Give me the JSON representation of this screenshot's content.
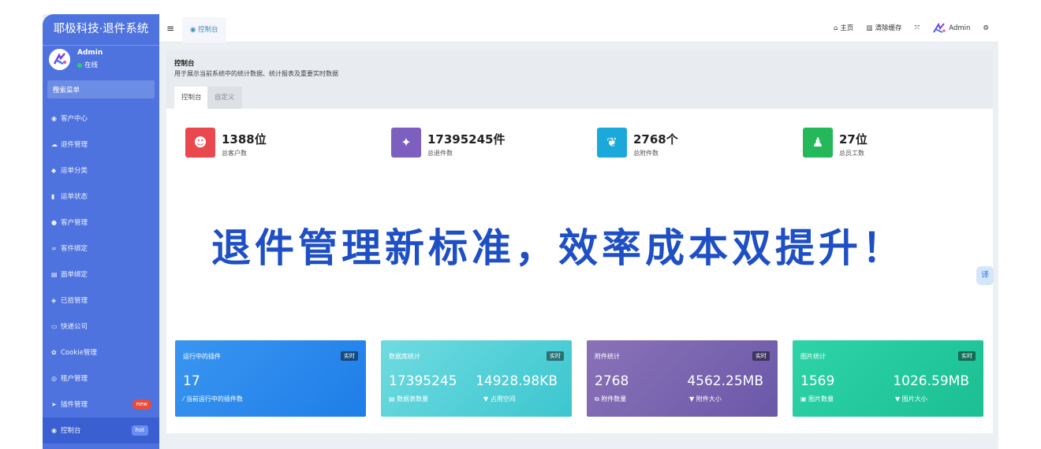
{
  "app": {
    "title": "耶极科技·退件系统"
  },
  "user": {
    "name": "Admin",
    "status": "在线"
  },
  "search": {
    "placeholder": "搜索菜单"
  },
  "menu": [
    {
      "label": "客户中心"
    },
    {
      "label": "退件管理"
    },
    {
      "label": "运单分类"
    },
    {
      "label": "运单状态"
    },
    {
      "label": "客户管理"
    },
    {
      "label": "客件绑定"
    },
    {
      "label": "面单绑定"
    },
    {
      "label": "已拾管理"
    },
    {
      "label": "快递公司"
    },
    {
      "label": "Cookie管理"
    },
    {
      "label": "租户管理"
    },
    {
      "label": "插件管理",
      "badge": "new"
    },
    {
      "label": "控制台",
      "badge": "hot"
    }
  ],
  "topbar": {
    "menu_glyph": "≡",
    "tab": "控制台",
    "home": "主页",
    "clear_cache": "清除缓存",
    "admin": "Admin"
  },
  "panel": {
    "title": "控制台",
    "description": "用于展示当前系统中的统计数据、统计报表及重要实时数据",
    "tabs": [
      "控制台",
      "自定义"
    ]
  },
  "stats": [
    {
      "value": "1388位",
      "label": "总客户数",
      "color": "#e9484f"
    },
    {
      "value": "17395245件",
      "label": "总退件数",
      "color": "#7c5fbf"
    },
    {
      "value": "2768个",
      "label": "总附件数",
      "color": "#1ba9db"
    },
    {
      "value": "27位",
      "label": "总员工数",
      "color": "#24b85a"
    }
  ],
  "headline": "退件管理新标准，效率成本双提升！",
  "cards": [
    {
      "title": "运行中的插件",
      "badge": "实时",
      "v1": "17",
      "v2": "",
      "s1": "当前运行中的插件数",
      "s2": ""
    },
    {
      "title": "数据库统计",
      "badge": "实时",
      "v1": "17395245",
      "v2": "14928.98KB",
      "s1": "数据表数量",
      "s2": "占用空间"
    },
    {
      "title": "附件统计",
      "badge": "实时",
      "v1": "2768",
      "v2": "4562.25MB",
      "s1": "附件数量",
      "s2": "附件大小"
    },
    {
      "title": "图片统计",
      "badge": "实时",
      "v1": "1569",
      "v2": "1026.59MB",
      "s1": "图片数量",
      "s2": "图片大小"
    }
  ],
  "float_button": "译"
}
